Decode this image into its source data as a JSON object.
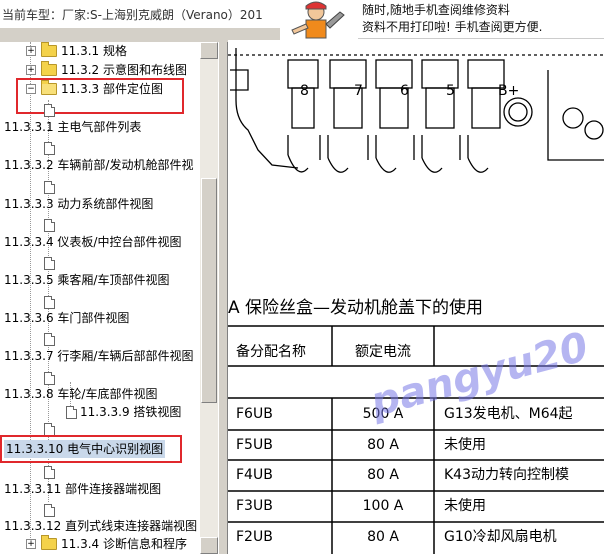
{
  "window": {
    "title": "当前车型：厂家:S-上海别克威朗（Verano）201"
  },
  "banner": {
    "line1": "随时,随地手机查阅维修资料",
    "line2": "资料不用打印啦! 手机查阅更方便."
  },
  "tree": {
    "items": [
      {
        "label": "11.3.1 规格"
      },
      {
        "label": "11.3.2 示意图和布线图"
      },
      {
        "label": "11.3.3 部件定位图"
      },
      {
        "label": "11.3.3.1 主电气部件列表"
      },
      {
        "label": "11.3.3.2 车辆前部/发动机舱部件视"
      },
      {
        "label": "11.3.3.3 动力系统部件视图"
      },
      {
        "label": "11.3.3.4 仪表板/中控台部件视图"
      },
      {
        "label": "11.3.3.5 乘客厢/车顶部件视图"
      },
      {
        "label": "11.3.3.6 车门部件视图"
      },
      {
        "label": "11.3.3.7 行李厢/车辆后部部件视图"
      },
      {
        "label": "11.3.3.8 车轮/车底部件视图"
      },
      {
        "label": "11.3.3.9 搭铁视图"
      },
      {
        "label": "11.3.3.10 电气中心识别视图"
      },
      {
        "label": "11.3.3.11 部件连接器端视图"
      },
      {
        "label": "11.3.3.12 直列式线束连接器端视图"
      },
      {
        "label": "11.3.4 诊断信息和程序"
      }
    ]
  },
  "content": {
    "diagram_labels": [
      "8",
      "7",
      "6",
      "5",
      "B+"
    ],
    "table_title": "A 保险丝盒—发动机舱盖下的使用",
    "headers": [
      "备分配名称",
      "额定电流",
      ""
    ],
    "rows": [
      {
        "name": "F6UB",
        "rating": "500 A",
        "use": "G13发电机、M64起"
      },
      {
        "name": "F5UB",
        "rating": "80 A",
        "use": "未使用"
      },
      {
        "name": "F4UB",
        "rating": "80 A",
        "use": "K43动力转向控制模"
      },
      {
        "name": "F3UB",
        "rating": "100 A",
        "use": "未使用"
      },
      {
        "name": "F2UB",
        "rating": "80 A",
        "use": "G10冷却风扇电机"
      }
    ],
    "watermark": "pangyu20"
  }
}
